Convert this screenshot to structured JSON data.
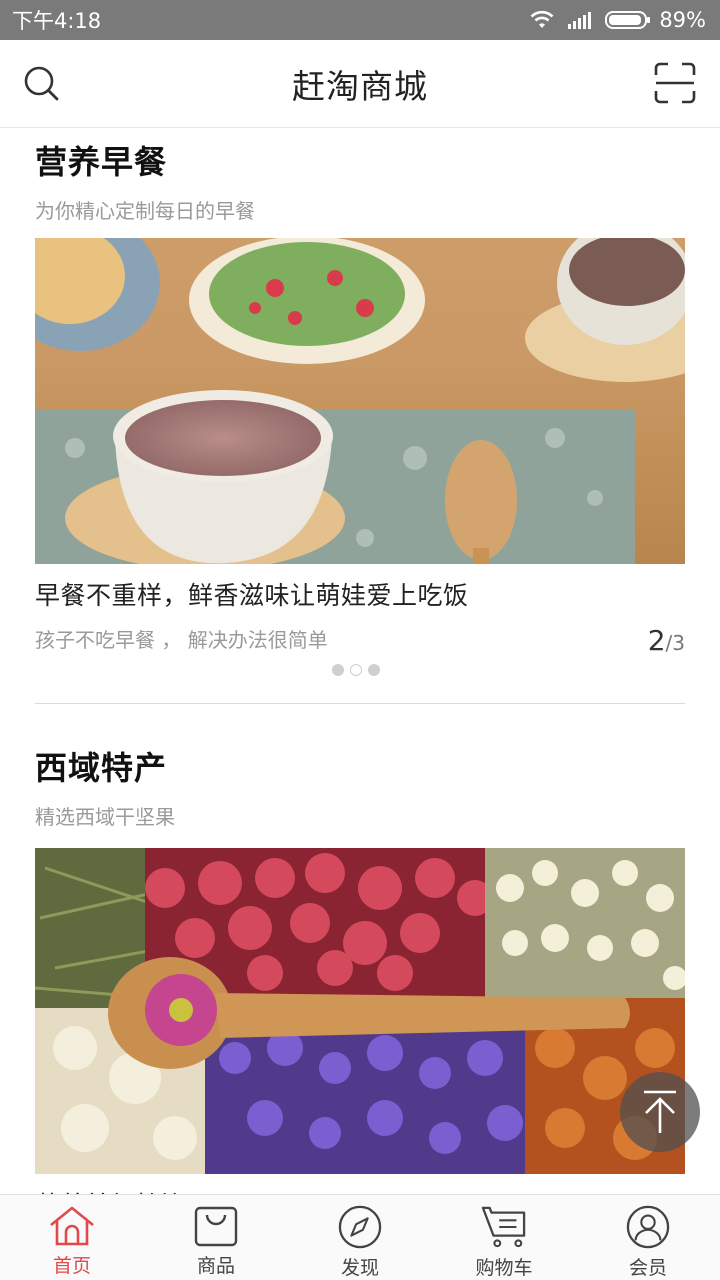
{
  "status_bar": {
    "time": "下午4:18",
    "battery": "89%"
  },
  "header": {
    "title": "赶淘商城"
  },
  "sections": [
    {
      "title": "营养早餐",
      "subtitle": "为你精心定制每日的早餐",
      "banner": {
        "headline": "早餐不重样，鲜香滋味让萌娃爱上吃饭",
        "subline": "孩子不吃早餐 ， 解决办法很简单",
        "page_current": "2",
        "page_total": "/3"
      }
    },
    {
      "title": "西域特产",
      "subtitle": "精选西域干坚果",
      "banner": {
        "headline": "营养美颜特饮品"
      }
    }
  ],
  "bottom_nav": [
    {
      "label": "首页",
      "icon": "home-icon",
      "active": true
    },
    {
      "label": "商品",
      "icon": "shopping-bag-icon",
      "active": false
    },
    {
      "label": "发现",
      "icon": "compass-icon",
      "active": false
    },
    {
      "label": "购物车",
      "icon": "cart-icon",
      "active": false
    },
    {
      "label": "会员",
      "icon": "user-icon",
      "active": false
    }
  ],
  "colors": {
    "accent": "#e04a4a",
    "status_bar": "#7a7a7a"
  }
}
